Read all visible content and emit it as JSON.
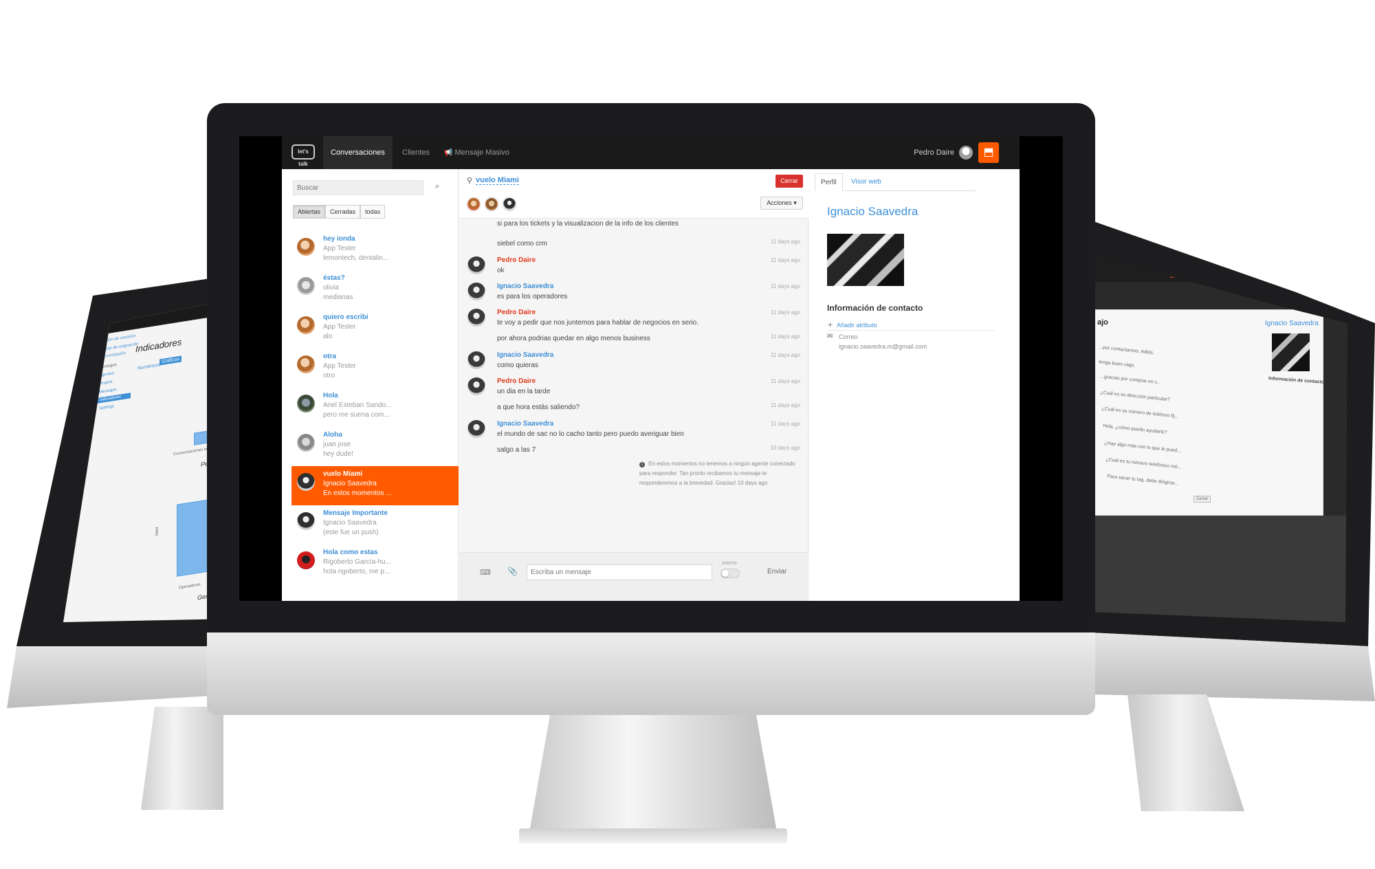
{
  "nav": {
    "logo": "let's talk",
    "tabs": [
      "Conversaciones",
      "Clientes",
      "Mensaje Masivo"
    ],
    "user_name": "Pedro Daire",
    "brand_icon": "chat-bubble-icon"
  },
  "sidebar": {
    "search_placeholder": "Buscar",
    "filters": [
      "Abiertas",
      "Cerradas",
      "todas"
    ],
    "conversations": [
      {
        "title": "hey ionda",
        "line1": "App Tester",
        "line2": "lemontech, dentalin..."
      },
      {
        "title": "éstas?",
        "line1": "olivia",
        "line2": "medianas"
      },
      {
        "title": "quiero escribi",
        "line1": "App Tester",
        "line2": "alo"
      },
      {
        "title": "otra",
        "line1": "App Tester",
        "line2": "otro"
      },
      {
        "title": "Hola",
        "line1": "Ariel Esteban Sando...",
        "line2": "pero me suena com..."
      },
      {
        "title": "Aloha",
        "line1": "juan jose",
        "line2": "hey dude!"
      },
      {
        "title": "vuelo Miami",
        "line1": "Ignacio Saavedra",
        "line2": "En estos momentos ..."
      },
      {
        "title": "Mensaje Importante",
        "line1": "Ignacio Saavedra",
        "line2": "(este fue un push)"
      },
      {
        "title": "Hola como estas",
        "line1": "Rigoberto García-hu...",
        "line2": "hola rigoberto, me p..."
      }
    ]
  },
  "chat": {
    "title": "vuelo Miami",
    "close_label": "Cerrar",
    "actions_label": "Acciones ▾",
    "messages": [
      {
        "text": "si para los tickets y la visualizacion de la info de los clientes"
      },
      {
        "text": "siebel como crm",
        "time": "11 days ago"
      },
      {
        "author": "Pedro Daire",
        "text": "ok",
        "time": "11 days ago"
      },
      {
        "author": "Ignacio Saavedra",
        "text": "es para los operadores",
        "time": "11 days ago"
      },
      {
        "author": "Pedro Daire",
        "text": "te voy a pedir que nos juntemos para hablar de negocios en serio.",
        "time": "11 days ago"
      },
      {
        "text": "por ahora podrias quedar en algo menos business",
        "time": "11 days ago"
      },
      {
        "author": "Ignacio Saavedra",
        "text": "como quieras",
        "time": "11 days ago"
      },
      {
        "author": "Pedro Daire",
        "text": "un dia en la tarde",
        "time": "11 days ago"
      },
      {
        "text": "a que hora estás saliendo?",
        "time": "11 days ago"
      },
      {
        "author": "Ignacio Saavedra",
        "text": "el mundo de sac no lo cacho tanto pero puedo averiguar bien",
        "time": "11 days ago"
      },
      {
        "text": "salgo a las 7",
        "time": "10 days ago"
      }
    ],
    "system_message": "En estos momentos no tenemos a ningún agente conectado para responder. Tan pronto recibamos tu mensaje te responderemos a la brevedad. Gracias! 10 days ago",
    "input_placeholder": "Escriba un mensaje",
    "internal_label": "Interno",
    "send_label": "Enviar"
  },
  "profile": {
    "tabs": [
      "Perfil",
      "Visor web"
    ],
    "name": "Ignacio Saavedra",
    "contact_title": "Información de contacto",
    "add_attribute": "Añadir atributo",
    "email_label": "Correo",
    "email_value": "ignacio.saavedra.m@gmail.com"
  },
  "left_monitor": {
    "title": "Indicadores",
    "tabs": [
      "Numéricos",
      "Gráficos"
    ],
    "chart_labels": [
      "Conversaciones en el (Ahora)",
      "Personal",
      "General",
      "Operadores",
      "Valor"
    ],
    "menu": [
      "Gestión de usuarios",
      "Reglas de asignación",
      "Sincronización",
      "Mensajes",
      "Agentes",
      "Grupos",
      "Mensajes",
      "Indicadores",
      "Settings"
    ]
  },
  "right_monitor": {
    "title": "ajo",
    "contact_title": "Información de contacto",
    "profile_name": "Ignacio Saavedra",
    "lines": [
      "...por contactarnos. Adiós.",
      "tenga buen viaje.",
      "...gracias por comprar en c...",
      "¿Cuál es su dirección particular?",
      "¿Cuál es su número de teléfono fij...",
      "Hola, ¿cómo puedo ayudarle?",
      "¿Hay algo más con lo que le pued...",
      "¿Cuál es tu número telefónico mó...",
      "Para sacar tu tag, debe dirigirse..."
    ],
    "close_label": "Cerrar"
  }
}
